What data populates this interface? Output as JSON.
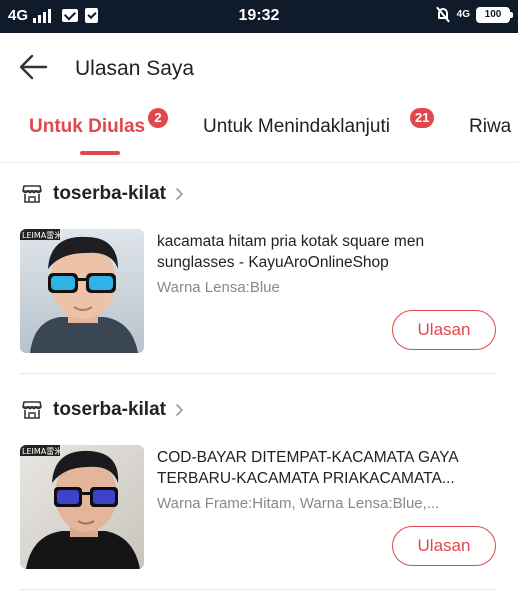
{
  "status_bar": {
    "network": "4G",
    "time": "19:32",
    "net_small": "4G",
    "battery": "100"
  },
  "header": {
    "title": "Ulasan Saya"
  },
  "tabs": [
    {
      "label": "Untuk Diulas",
      "badge": "2",
      "active": true
    },
    {
      "label": "Untuk Menindaklanjuti",
      "badge": "21",
      "active": false
    },
    {
      "label": "Riwa",
      "badge": null,
      "active": false
    }
  ],
  "items": [
    {
      "store": "toserba-kilat",
      "title": "kacamata hitam pria kotak square men sunglasses - KayuAroOnlineShop",
      "variant": "Warna Lensa:Blue",
      "button": "Ulasan",
      "thumb_label": "LEIMA雷米",
      "lens_color": "#2fb3e6"
    },
    {
      "store": "toserba-kilat",
      "title": "COD-BAYAR DITEMPAT-KACAMATA GAYA TERBARU-KACAMATA PRIAKACAMATA...",
      "variant": "Warna Frame:Hitam, Warna Lensa:Blue,...",
      "button": "Ulasan",
      "thumb_label": "LEIMA雷米",
      "lens_color": "#3b44c8"
    }
  ],
  "colors": {
    "accent": "#e0484c",
    "status_bar": "#0f1b2a",
    "muted_text": "#888888"
  }
}
